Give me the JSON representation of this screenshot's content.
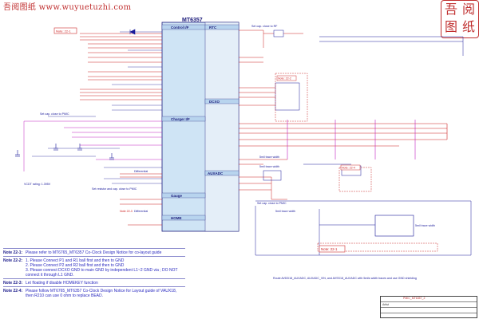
{
  "watermark": {
    "site_text": "吾阅图纸 www.wuyuetuzhi.com",
    "logo_chars": [
      "吾",
      "阅",
      "图",
      "纸"
    ]
  },
  "chip": {
    "name": "MT6357",
    "sections": [
      {
        "label": "Control I/F",
        "icon": "gear"
      },
      {
        "label": "RTC",
        "icon": "clock"
      },
      {
        "label": "DCXO",
        "icon": "crystal"
      },
      {
        "label": "Charger I/F",
        "icon": "battery"
      },
      {
        "label": "AUXADC",
        "icon": "adc"
      },
      {
        "label": "Gauge",
        "icon": "gauge"
      },
      {
        "label": "HOME",
        "icon": "home"
      }
    ]
  },
  "callouts": {
    "note_22_1_top": "Note: 22-1",
    "note_22_2": "Note: 22-2",
    "note_22_1_bottom": "Note: 22-1",
    "note_22_4": "Note: 22-4",
    "note_22_3": "Note 22-3",
    "differential_1": "Differential",
    "differential_2": "Differential",
    "setcap_1": "Set cap. close to PMIC",
    "setcap_2": "Set cap. close to RF",
    "setcap_3": "Set resistor and cap. close to PMIC",
    "setcap_4": "Set cap. close to PMIC",
    "vcc_rating": "VCDT rating: 1.395V",
    "trace_width_1": "5mil trace width",
    "trace_width_2": "5mil trace width",
    "trace_width_3": "5mil trace width",
    "trace_width_4": "5mil trace width",
    "route_note": "Route AVDD18_AUXADC, AUXADC_VIN, and AVSS18_AUXADC with 5mils width traces and use GND shielding"
  },
  "notes": [
    {
      "key": "Note 22-1:",
      "text": "Please refer to MT6765_MT6357 Co-Clock Design Notice for co-layout guide"
    },
    {
      "key": "Note 22-2:",
      "text": "1. Please Connect P1 and R1 ball first and then to GND\n2. Please Connect P2 and R2 ball first and then to GND\n3. Please connect DCXO GND to main GND by independent L1~2 GND via ; DO NOT connect it through L1 GND."
    },
    {
      "key": "Note 22-3:",
      "text": "Let floating if disable HOMEKEY function"
    },
    {
      "key": "Note 22-4:",
      "text": "Please follow MT6765_MT6357 Co-Clock Design Notice for Layout guide of VAUX18,\nthen R210 can use 0 ohm to replace BEAD."
    }
  ],
  "title_block": {
    "row1": "",
    "row2": "Artist",
    "row3": "",
    "label": "PMIC_MT6357_2"
  },
  "colors": {
    "chip_fill": "#cfe4f5",
    "chip_border": "#1a1a7a",
    "wire_red": "#cc2020",
    "wire_blue": "#1a1a9a",
    "wire_magenta": "#c020c0",
    "note_box": "#cc3030"
  }
}
